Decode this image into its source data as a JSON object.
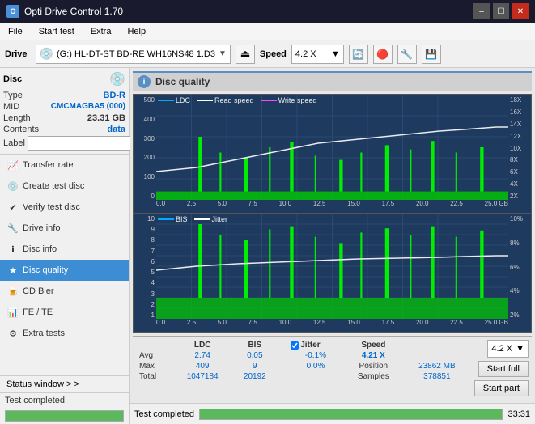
{
  "window": {
    "title": "Opti Drive Control 1.70",
    "minimize": "–",
    "maximize": "☐",
    "close": "✕"
  },
  "menu": {
    "items": [
      "File",
      "Start test",
      "Extra",
      "Help"
    ]
  },
  "toolbar": {
    "drive_label": "Drive",
    "drive_value": "(G:) HL-DT-ST BD-RE  WH16NS48 1.D3",
    "speed_label": "Speed",
    "speed_value": "4.2 X"
  },
  "disc": {
    "title": "Disc",
    "type_label": "Type",
    "type_value": "BD-R",
    "mid_label": "MID",
    "mid_value": "CMCMAGBA5 (000)",
    "length_label": "Length",
    "length_value": "23.31 GB",
    "contents_label": "Contents",
    "contents_value": "data",
    "label_label": "Label"
  },
  "nav": {
    "items": [
      {
        "id": "transfer-rate",
        "label": "Transfer rate",
        "icon": "📈"
      },
      {
        "id": "create-test-disc",
        "label": "Create test disc",
        "icon": "💿"
      },
      {
        "id": "verify-test-disc",
        "label": "Verify test disc",
        "icon": "✔"
      },
      {
        "id": "drive-info",
        "label": "Drive info",
        "icon": "🔧"
      },
      {
        "id": "disc-info",
        "label": "Disc info",
        "icon": "ℹ"
      },
      {
        "id": "disc-quality",
        "label": "Disc quality",
        "icon": "★",
        "active": true
      },
      {
        "id": "cd-bier",
        "label": "CD Bier",
        "icon": "🍺"
      },
      {
        "id": "fe-te",
        "label": "FE / TE",
        "icon": "📊"
      },
      {
        "id": "extra-tests",
        "label": "Extra tests",
        "icon": "⚙"
      }
    ]
  },
  "disc_quality": {
    "title": "Disc quality",
    "legend": {
      "ldc": "LDC",
      "read_speed": "Read speed",
      "write_speed": "Write speed"
    },
    "legend_bottom": {
      "bis": "BIS",
      "jitter": "Jitter"
    },
    "top_chart": {
      "y_left": [
        "500",
        "400",
        "300",
        "200",
        "100",
        "0"
      ],
      "y_right": [
        "18X",
        "16X",
        "14X",
        "12X",
        "10X",
        "8X",
        "6X",
        "4X",
        "2X"
      ],
      "x": [
        "0.0",
        "2.5",
        "5.0",
        "7.5",
        "10.0",
        "12.5",
        "15.0",
        "17.5",
        "20.0",
        "22.5",
        "25.0 GB"
      ]
    },
    "bottom_chart": {
      "y_left": [
        "10",
        "9",
        "8",
        "7",
        "6",
        "5",
        "4",
        "3",
        "2",
        "1"
      ],
      "y_right": [
        "10%",
        "8%",
        "6%",
        "4%",
        "2%"
      ],
      "x": [
        "0.0",
        "2.5",
        "5.0",
        "7.5",
        "10.0",
        "12.5",
        "15.0",
        "17.5",
        "20.0",
        "22.5",
        "25.0 GB"
      ]
    }
  },
  "stats": {
    "headers": [
      "",
      "LDC",
      "BIS",
      "",
      "Jitter",
      "Speed",
      ""
    ],
    "avg_label": "Avg",
    "avg_ldc": "2.74",
    "avg_bis": "0.05",
    "avg_jitter": "-0.1%",
    "max_label": "Max",
    "max_ldc": "409",
    "max_bis": "9",
    "max_jitter": "0.0%",
    "total_label": "Total",
    "total_ldc": "1047184",
    "total_bis": "20192",
    "speed_label": "Speed",
    "speed_value": "4.21 X",
    "speed_dropdown": "4.2 X",
    "position_label": "Position",
    "position_value": "23862 MB",
    "samples_label": "Samples",
    "samples_value": "378851",
    "jitter_checked": true,
    "jitter_label": "Jitter"
  },
  "actions": {
    "start_full": "Start full",
    "start_part": "Start part"
  },
  "status": {
    "window_btn": "Status window > >",
    "completed_text": "Test completed",
    "progress": 100,
    "time": "33:31"
  }
}
